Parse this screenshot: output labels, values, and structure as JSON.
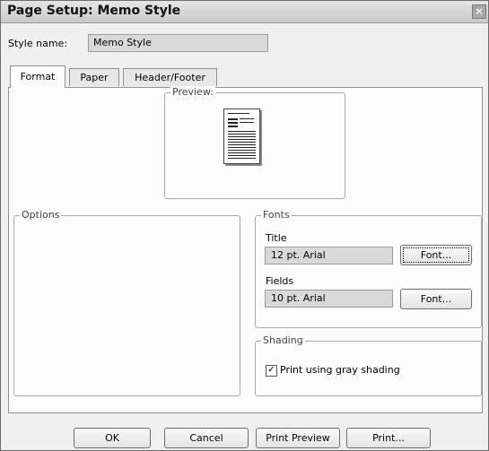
{
  "window": {
    "title": "Page Setup: Memo Style"
  },
  "style_name": {
    "label": "Style name:",
    "value": "Memo Style"
  },
  "tabs": [
    {
      "label": "Format",
      "active": true
    },
    {
      "label": "Paper",
      "active": false
    },
    {
      "label": "Header/Footer",
      "active": false
    }
  ],
  "preview": {
    "legend": "Preview:"
  },
  "options": {
    "legend": "Options"
  },
  "fonts": {
    "legend": "Fonts",
    "title_label": "Title",
    "title_value": "12 pt. Arial",
    "title_button": "Font...",
    "fields_label": "Fields",
    "fields_value": "10 pt. Arial",
    "fields_button": "Font..."
  },
  "shading": {
    "legend": "Shading",
    "checkbox_label": "Print using gray shading",
    "checked": true
  },
  "footer": {
    "ok": "OK",
    "cancel": "Cancel",
    "print_preview": "Print Preview",
    "print": "Print..."
  },
  "icons": {
    "close": "close-icon",
    "check": "checkmark-icon"
  }
}
